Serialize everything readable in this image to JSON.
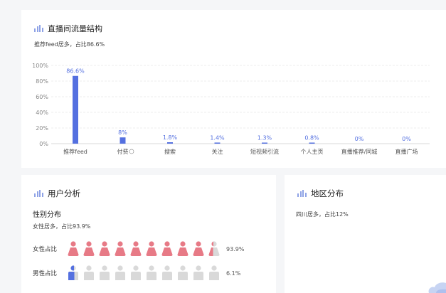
{
  "traffic": {
    "title": "直播间流量结构",
    "subtitle": "推荐feed居多，占比86.6%"
  },
  "chart_data": {
    "type": "bar",
    "categories": [
      "推荐feed",
      "付费",
      "搜索",
      "关注",
      "短视频引流",
      "个人主页",
      "直播推荐/同城",
      "直播广场"
    ],
    "values": [
      86.6,
      8,
      1.8,
      1.4,
      1.3,
      0.8,
      0,
      0
    ],
    "value_labels": [
      "86.6%",
      "8%",
      "1.8%",
      "1.4%",
      "1.3%",
      "0.8%",
      "0%",
      "0%"
    ],
    "ylim": [
      0,
      100
    ],
    "yticks": [
      "0%",
      "20%",
      "40%",
      "60%",
      "80%",
      "100%"
    ],
    "grid": true,
    "bar_color": "#5470e0",
    "info_icon_category_index": 1
  },
  "user": {
    "title": "用户分析",
    "gender_title": "性别分布",
    "gender_subtitle": "女性居多，占比93.9%",
    "female": {
      "label": "女性占比",
      "pct_text": "93.9%",
      "fraction": 0.939,
      "color": "#e77a86"
    },
    "male": {
      "label": "男性占比",
      "pct_text": "6.1%",
      "fraction": 0.061,
      "color": "#5470e0"
    },
    "empty_color": "#d9d9d9",
    "icon_count": 10
  },
  "region": {
    "title": "地区分布",
    "subtitle": "四川居多，占比12%"
  }
}
